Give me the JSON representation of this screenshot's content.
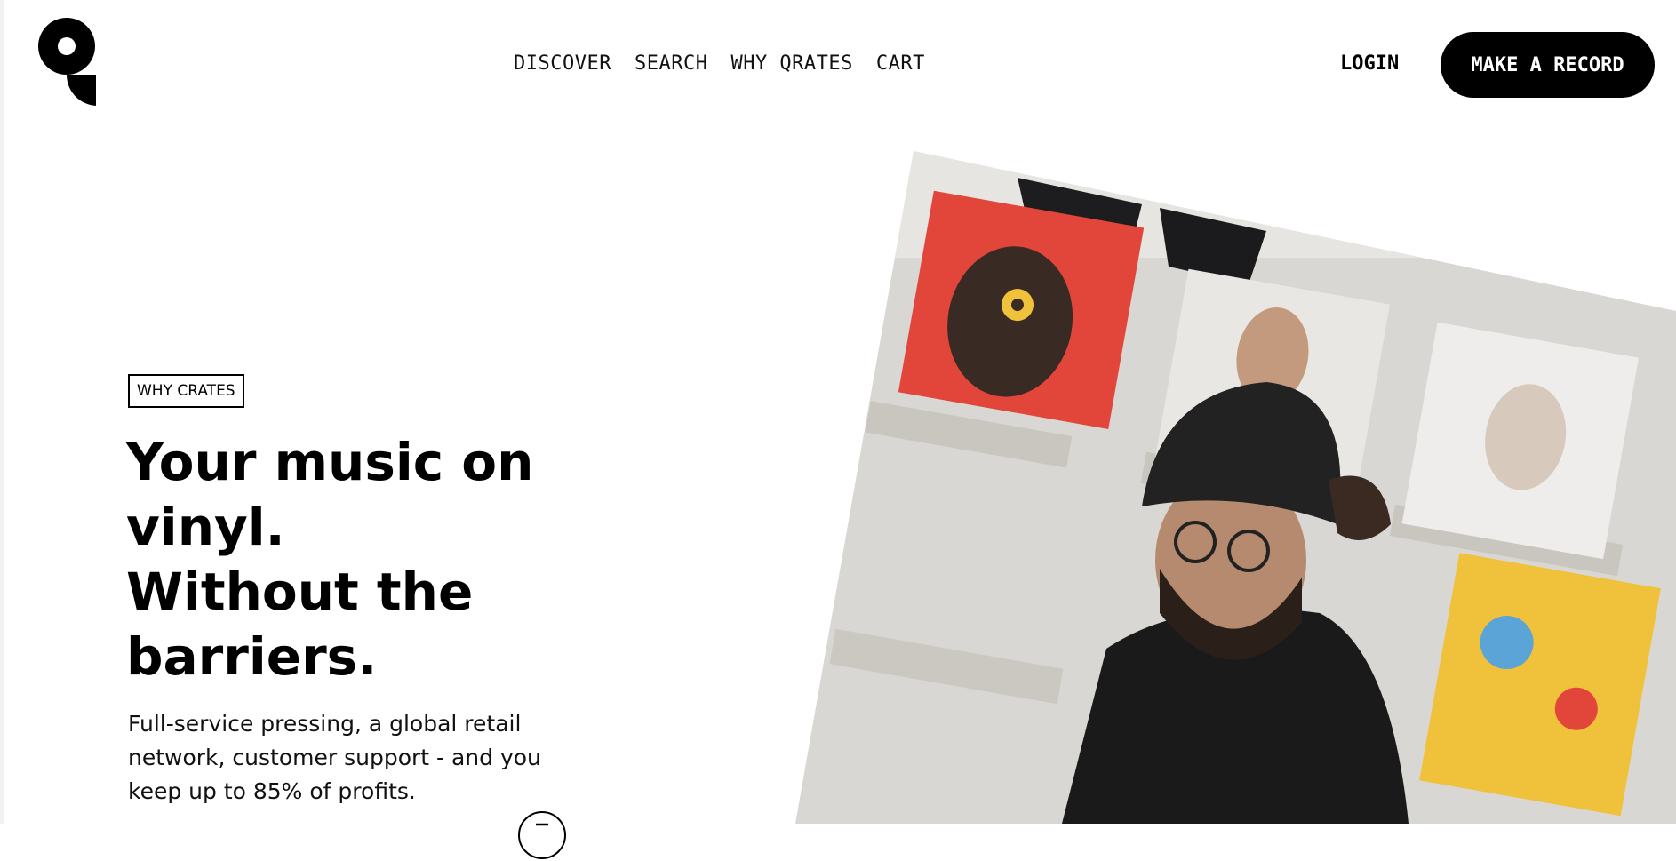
{
  "brand": {
    "logo_icon": "qrates-logo-icon"
  },
  "nav": {
    "items": [
      {
        "label": "DISCOVER"
      },
      {
        "label": "SEARCH"
      },
      {
        "label": "WHY QRATES"
      },
      {
        "label": "CART"
      }
    ]
  },
  "header": {
    "login_label": "LOGIN",
    "cta_label": "MAKE A RECORD"
  },
  "hero": {
    "tag": "WHY CRATES",
    "headline_lines": [
      "Your music on",
      "vinyl.",
      "Without the",
      "barriers."
    ],
    "subtext": "Full-service pressing, a global retail network, customer support - and you keep up to 85% of profits.",
    "scroll_icon": "chevron-down-icon"
  },
  "colors": {
    "primary": "#000000",
    "background": "#ffffff",
    "record_red": "#e2463a",
    "record_yellow": "#f0c23b"
  }
}
